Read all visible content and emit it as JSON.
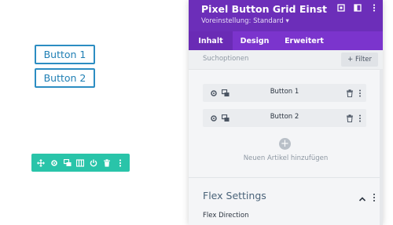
{
  "preview": {
    "buttons": [
      "Button 1",
      "Button 2"
    ]
  },
  "toolbar": {
    "icons": [
      "move-icon",
      "gear-icon",
      "duplicate-icon",
      "columns-icon",
      "power-icon",
      "trash-icon",
      "more-icon"
    ]
  },
  "panel": {
    "title": "Pixel Button Grid Einstellun…",
    "preset": "Voreinstellung: Standard ▾",
    "tabs": [
      "Inhalt",
      "Design",
      "Erweitert"
    ],
    "search_placeholder": "Suchoptionen",
    "filter_label": "+ Filter",
    "items": [
      {
        "label": "Button 1"
      },
      {
        "label": "Button 2"
      }
    ],
    "add_label": "Neuen Artikel hinzufügen",
    "section_title": "Flex Settings",
    "flex_direction_label": "Flex Direction"
  },
  "colors": {
    "header": "#6c2eb9",
    "tabs": "#7b34cd",
    "toolbar": "#29c4a9",
    "button_border": "#2c8dc2"
  }
}
